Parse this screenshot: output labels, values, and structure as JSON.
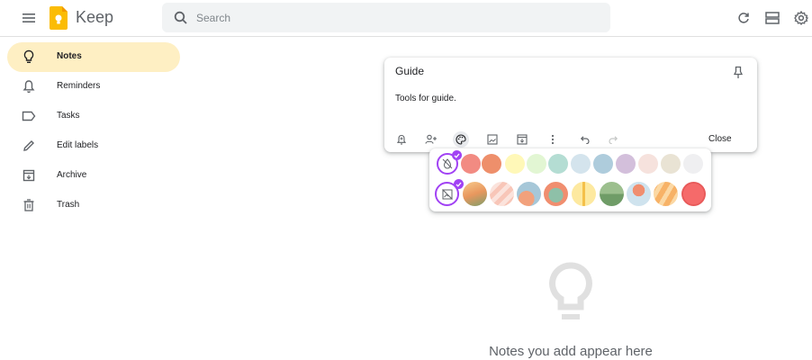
{
  "app": {
    "title": "Keep",
    "brand_color": "#fbbc04"
  },
  "search": {
    "placeholder": "Search"
  },
  "header_icons": [
    "refresh-icon",
    "list-view-icon",
    "settings-icon"
  ],
  "sidebar": {
    "items": [
      {
        "label": "Notes",
        "icon": "lightbulb-icon",
        "active": true
      },
      {
        "label": "Reminders",
        "icon": "bell-icon"
      },
      {
        "label": "Tasks",
        "icon": "label-outline-icon"
      },
      {
        "label": "Edit labels",
        "icon": "pencil-icon"
      },
      {
        "label": "Archive",
        "icon": "archive-icon"
      },
      {
        "label": "Trash",
        "icon": "trash-icon"
      }
    ]
  },
  "note": {
    "title": "Guide",
    "body": "Tools for guide.",
    "close_label": "Close",
    "toolbar": [
      "remind-me-icon",
      "collaborator-icon",
      "background-options-icon",
      "add-image-icon",
      "archive-icon",
      "more-icon",
      "undo-icon",
      "redo-icon"
    ]
  },
  "palette": {
    "colors": [
      "#f28b82",
      "#ee8f6b",
      "#fff8b8",
      "#e2f6d3",
      "#b4ddd3",
      "#d4e4ed",
      "#aeccdc",
      "#d3bfdb",
      "#f6e2dd",
      "#e9e3d4",
      "#efeff1"
    ],
    "selected_accent": "#a142f4",
    "backgrounds": [
      "groceries",
      "food",
      "music",
      "recipes",
      "notes",
      "places",
      "travel",
      "video",
      "celebration"
    ]
  },
  "empty_state": {
    "text": "Notes you add appear here"
  }
}
